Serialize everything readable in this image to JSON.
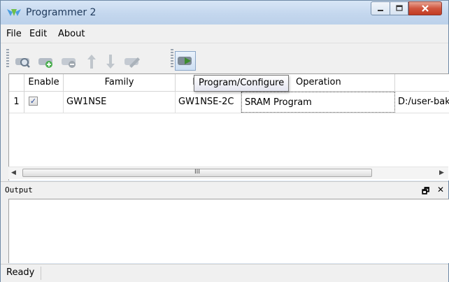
{
  "window": {
    "title": "Programmer 2"
  },
  "menu": {
    "items": [
      "File",
      "Edit",
      "About"
    ]
  },
  "toolbar": {
    "buttons": [
      "scan-device-icon",
      "add-device-icon",
      "remove-device-icon",
      "move-up-icon",
      "move-down-icon",
      "edit-config-icon",
      "program-configure-icon"
    ],
    "tooltip": "Program/Configure"
  },
  "table": {
    "headers": [
      "Enable",
      "Family",
      "Device",
      "Operation"
    ],
    "rows": [
      {
        "num": "1",
        "enabled": true,
        "family": "GW1NSE",
        "device": "GW1NSE-2C",
        "operation": "SRAM Program",
        "file": "D:/user-bak"
      }
    ],
    "scroll_thumb_label": "III"
  },
  "output": {
    "title": "Output"
  },
  "status": {
    "text": "Ready"
  },
  "colors": {
    "accent": "#3c8d2f",
    "close": "#c23b22"
  }
}
